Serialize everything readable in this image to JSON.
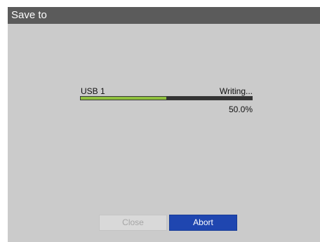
{
  "window": {
    "title": "Save to"
  },
  "transfer": {
    "device": "USB 1",
    "status": "Writing...",
    "progress_percent": 50.0,
    "progress_text": "50.0%"
  },
  "buttons": {
    "close_label": "Close",
    "close_enabled": false,
    "abort_label": "Abort"
  },
  "colors": {
    "title_bar": "#5b5b5b",
    "dialog_background": "#cbcbcb",
    "progress_fill": "#8fc03e",
    "progress_track": "#333333",
    "abort_button": "#1f46b0"
  }
}
